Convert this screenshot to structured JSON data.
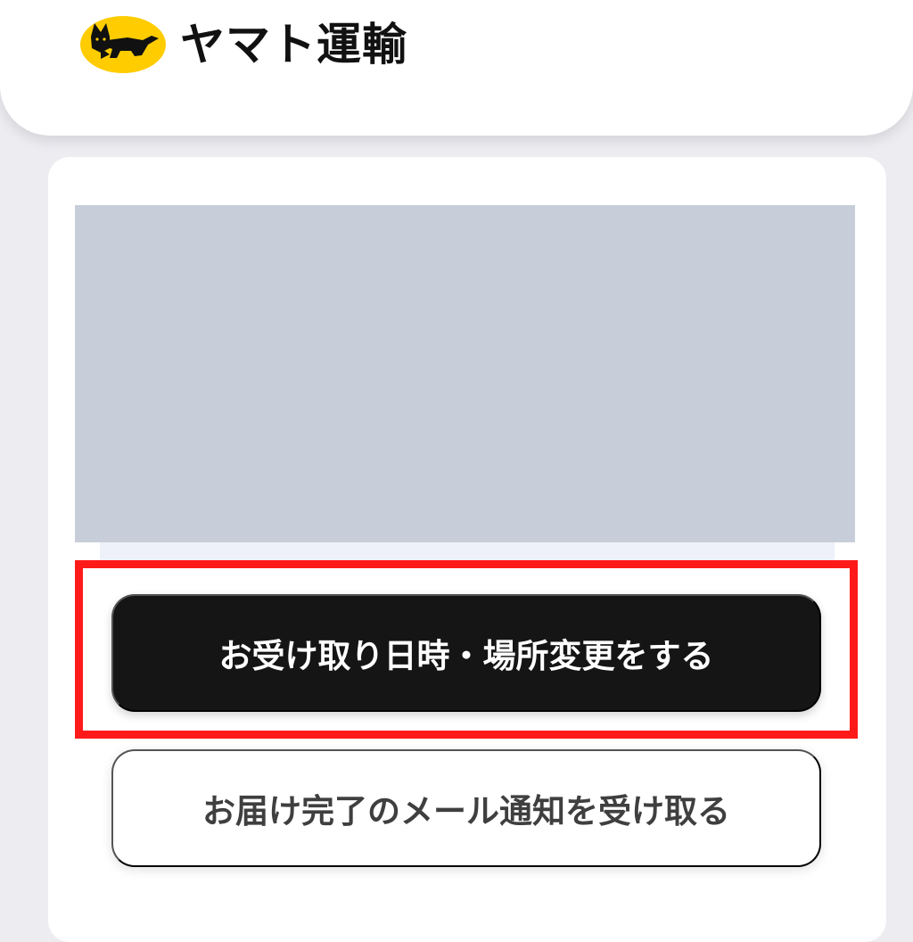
{
  "header": {
    "brand_name": "ヤマト運輸",
    "logo_icon": "black-cat-logo-icon",
    "logo_color": "#ffcc00"
  },
  "main": {
    "image": "image-placeholder",
    "primary_action_label": "お受け取り日時・場所変更をする",
    "secondary_action_label": "お届け完了のメール通知を受け取る"
  },
  "colors": {
    "highlight": "#ff1a1a",
    "primary_button": "#151515",
    "page_background": "#ececf1"
  }
}
